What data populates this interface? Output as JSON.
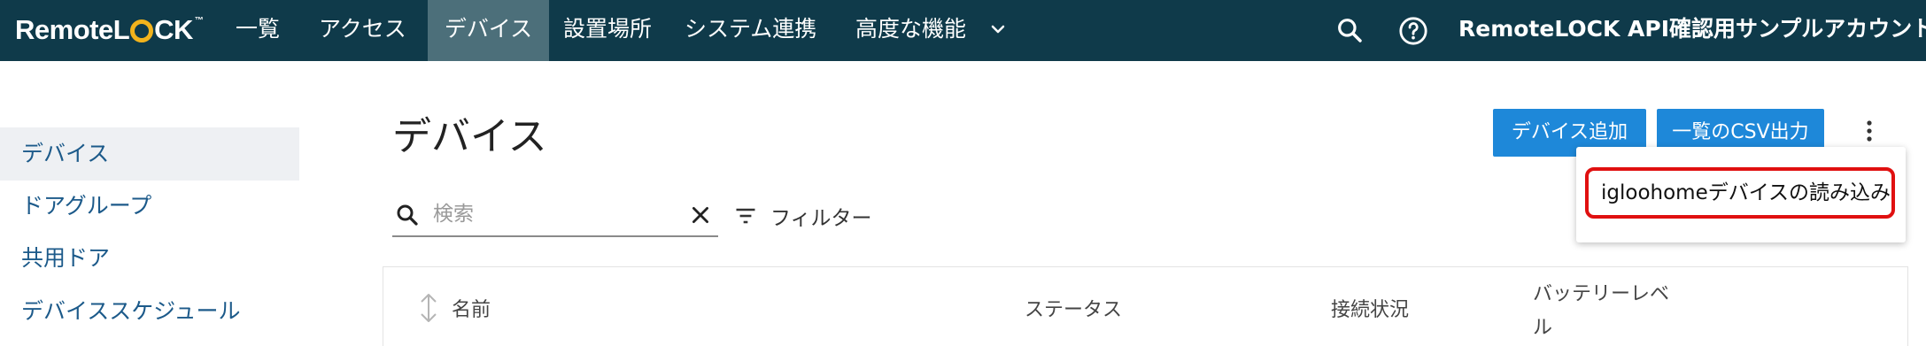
{
  "header": {
    "logo_text_1": "Remote",
    "logo_text_2": "L",
    "logo_text_3": "CK",
    "logo_tm": "™",
    "nav": [
      {
        "label": "一覧"
      },
      {
        "label": "アクセス"
      },
      {
        "label": "デバイス",
        "active": true
      },
      {
        "label": "設置場所"
      },
      {
        "label": "システム連携"
      },
      {
        "label": "高度な機能"
      }
    ],
    "account_name": "RemoteLOCK API確認用サンプルアカウント"
  },
  "sidebar": {
    "items": [
      {
        "label": "デバイス",
        "active": true
      },
      {
        "label": "ドアグループ"
      },
      {
        "label": "共用ドア"
      },
      {
        "label": "デバイススケジュール"
      }
    ]
  },
  "main": {
    "title": "デバイス",
    "add_device_button": "デバイス追加",
    "csv_export_button": "一覧のCSV出力",
    "search": {
      "placeholder": "検索",
      "value": ""
    },
    "filter_label": "フィルター",
    "table": {
      "columns": [
        "名前",
        "ステータス",
        "接続状況",
        "バッテリーレベ",
        "ル"
      ]
    }
  },
  "dropdown": {
    "items": [
      {
        "label": "igloohomeデバイスの読み込み",
        "highlighted": true
      }
    ]
  },
  "colors": {
    "nav_bg": "#0f3a4a",
    "nav_active": "#4c6f7a",
    "primary": "#1e88d9",
    "link": "#1c5a8a",
    "logo_accent": "#f2b31c",
    "highlight": "#e01010"
  },
  "icons": {
    "nav_more": "chevron-down-icon",
    "search": "search-icon",
    "help": "help-circle-icon",
    "more": "kebab-vertical-icon",
    "clear": "close-icon",
    "filter": "filter-icon",
    "sort": "sort-icon"
  }
}
